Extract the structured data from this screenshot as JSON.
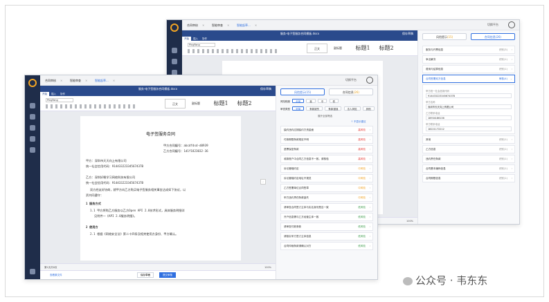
{
  "tabs": [
    "合同审核",
    "智能审查",
    "智能起草..."
  ],
  "tabs_back": [
    "合同审核",
    "智能审查",
    "智能起草..."
  ],
  "header_right": "切换平台",
  "doc": {
    "title": "服务-电子签服务合同模板.docx",
    "save": "保存草稿",
    "ribbon_tabs": [
      "开始",
      "插入",
      "协作"
    ],
    "font": "PingFang",
    "styles": [
      "正文",
      "标题1",
      "标题2"
    ],
    "style_small": "副标题",
    "heading": "电子签服务合同",
    "lines": [
      "甲方合同编号：abcdfdsd-d0939",
      "乙方合同编号：1d1f1823032-36",
      "甲方：深圳市天天向上有限公司",
      "统一社会信用代码：91443322334567437B",
      "乙方：深圳好睡学习网络科技有限公司",
      "统一社会信用代码：91443322334567437B",
      "双方经友好协商，就甲方向乙方购买电子签服务相关事宜达成如下协议，以",
      "资共同遵守：",
      "1  服务方式",
      "1.1  甲方将购乙方服务以乙方Open API 2.0技术形式，具体服务明细详",
      "见附件一《API 2.0服务明细》。",
      "2  使用方",
      "2.1  根据《网络安全法》第二十四条及相关使用方身份、甲方确认。"
    ],
    "status_left": "第1页共8页",
    "status_right": "100%",
    "footer_left": "查看原文件",
    "btn_save": "保存草稿",
    "btn_submit": "提交审核"
  },
  "panel": {
    "tab_risk": "风险提示",
    "tab_risk_count": "(15)",
    "tab_fields": "合同信息",
    "tab_fields_count": "(26)",
    "risk_label": "风险程度",
    "risk_chips": [
      "全部",
      "高",
      "中",
      "低"
    ],
    "type_label": "审查类型",
    "type_chips": [
      "全部",
      "条款缺失",
      "条款错误",
      "法人风险",
      "其他"
    ],
    "expand": "展开全部筛选",
    "sort_hint": "↑ 不显示建议",
    "risks": [
      {
        "name": "缺约违约应按缺约方资金面",
        "level": "高风险",
        "cls": "high"
      },
      {
        "name": "付款期限条款规定不明",
        "level": "高风险",
        "cls": "high"
      },
      {
        "name": "退票保密条款",
        "level": "高风险",
        "cls": "high"
      },
      {
        "name": "收款账户中合同乙方信息不一致，请核验",
        "level": "高风险",
        "cls": "high"
      },
      {
        "name": "诉讼管辖约定",
        "level": "中风险",
        "cls": "mid"
      },
      {
        "name": "诉讼管辖约定地址不规范",
        "level": "中风险",
        "cls": "mid"
      },
      {
        "name": "乙方签署单位合同签章",
        "level": "中风险",
        "cls": "mid"
      },
      {
        "name": "甲方违约责任条款缺失",
        "level": "中风险",
        "cls": "mid"
      },
      {
        "name": "请审查合同签订主体与实名身份是否一致",
        "level": "低风险",
        "cls": "low"
      },
      {
        "name": "开户信息需与乙方经营主体一致",
        "level": "低风险",
        "cls": "low"
      },
      {
        "name": "请审查付款条款",
        "level": "低风险",
        "cls": "low"
      },
      {
        "name": "请核实甲方签订主体信息",
        "level": "低风险",
        "cls": "low"
      },
      {
        "name": "合同仲裁条款请确认对方",
        "level": "低风险",
        "cls": "low"
      }
    ],
    "fields": [
      {
        "name": "服务与开票信息",
        "state": "识别(3)"
      },
      {
        "name": "争议解决",
        "state": "识别(1)"
      },
      {
        "name": "费用与结算信息",
        "state": "识别(1)"
      },
      {
        "name": "合同签署双方信息",
        "state": "审核(4)",
        "open": true
      }
    ],
    "field_detail": [
      {
        "label": "甲方统一社会信用代码",
        "value": "91443322334567437B"
      },
      {
        "label": "甲方名称",
        "value": "深圳市天天向上有限公司"
      },
      {
        "label": "乙方联系电话",
        "value": "18934186136"
      },
      {
        "label": "甲方联系电话",
        "value": "18221172212"
      }
    ],
    "fields_after": [
      {
        "name": "其他",
        "state": "识别(1)"
      },
      {
        "name": "乙方信息",
        "state": "识别(1)"
      },
      {
        "name": "违约责任条款",
        "state": "识别(1)"
      },
      {
        "name": "合同基本编码信息",
        "state": "识别(1)"
      },
      {
        "name": "合同期限信息",
        "state": "识别(1)"
      }
    ]
  },
  "watermark": "公众号 · 韦东东"
}
